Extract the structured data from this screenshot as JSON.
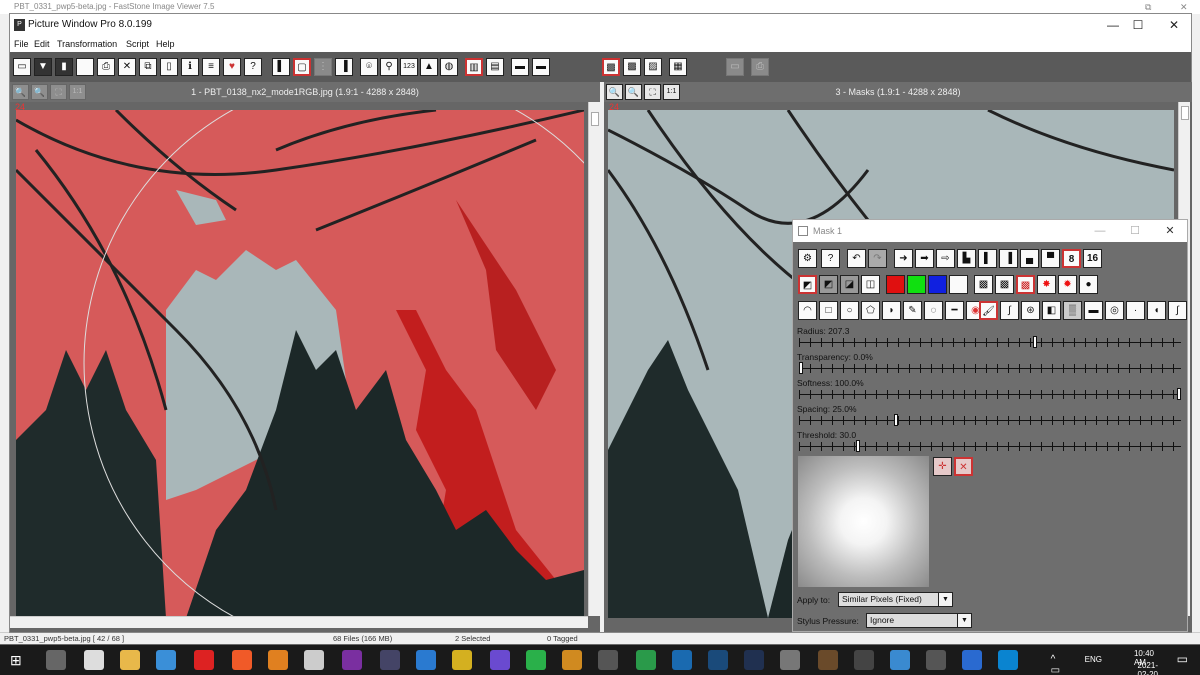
{
  "bg_window": {
    "title": "PBT_0331_pwp5-beta.jpg  -  FastStone Image Viewer 7.5",
    "status_file": "PBT_0331_pwp5-beta.jpg [ 42 / 68 ]",
    "status_files": "68 Files (166 MB)",
    "status_selected": "2 Selected",
    "status_tagged": "0 Tagged"
  },
  "window": {
    "title": "Picture Window Pro 8.0.199",
    "minimize": "—",
    "maximize": "☐",
    "close": "✕"
  },
  "menu": [
    "File",
    "Edit",
    "Transformation",
    "Script",
    "Help"
  ],
  "left_pane": {
    "title": "1 - PBT_0138_nx2_mode1RGB.jpg (1.9:1 - 4288 x 2848)",
    "zoom_index": "24",
    "tools": [
      "🔍",
      "🔍",
      "⛶",
      "1:1"
    ]
  },
  "right_pane": {
    "title": "3 - Masks (1.9:1 - 4288 x 2848)",
    "zoom_index": "24",
    "tools": [
      "🔍",
      "🔍",
      "⛶",
      "1:1"
    ]
  },
  "mask_dialog": {
    "title": "Mask 1",
    "bits": [
      "8",
      "16"
    ],
    "sliders": [
      {
        "label": "Radius: 207.3",
        "value": 0.62
      },
      {
        "label": "Transparency: 0.0%",
        "value": 0.0
      },
      {
        "label": "Softness: 100.0%",
        "value": 1.0
      },
      {
        "label": "Spacing: 25.0%",
        "value": 0.25
      },
      {
        "label": "Threshold: 30.0",
        "value": 0.15
      }
    ],
    "apply_to_label": "Apply to:",
    "apply_to_value": "Similar Pixels (Fixed)",
    "stylus_label": "Stylus Pressure:",
    "stylus_value": "Ignore"
  },
  "taskbar": {
    "language": "ENG",
    "time": "10:40 AM",
    "date": "2021-02-20"
  },
  "colors": {
    "mask_red": "#d65a5a",
    "sky": "#a9b7b9",
    "accent_red": "#cc3333"
  }
}
